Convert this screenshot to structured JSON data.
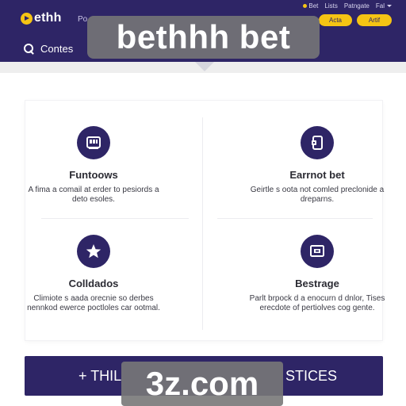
{
  "header": {
    "logo_text": "ethh",
    "nav_label": "Po",
    "util_links": [
      "Bet",
      "Lists",
      "Patngate",
      "Fal"
    ],
    "login_label": "Acta",
    "signup_label": "Artif",
    "search_label": "Contes"
  },
  "watermark": {
    "top": "bethhh bet",
    "bottom": "3z.com"
  },
  "features": [
    {
      "icon": "slot-machine-icon",
      "title": "Funtoows",
      "description": "A fima a comail at erder to pesiords a deto esoles."
    },
    {
      "icon": "mobile-bet-icon",
      "title": "Earrnot bet",
      "description": "Geirtle s oota not comled preclonide a dreparns."
    },
    {
      "icon": "star-icon",
      "title": "Colldados",
      "description": "Climiote s aada orecnie so derbes nennkod ewerce poctloles car ootmal."
    },
    {
      "icon": "screen-icon",
      "title": "Bestrage",
      "description": "Parlt brpock d a enocurn d dnlor, Tises erecdote of pertiolves cog gente."
    }
  ],
  "cta": {
    "left_text": "+ THIL",
    "right_text": "STICES"
  },
  "colors": {
    "brand_purple": "#2e2566",
    "accent_yellow": "#f5c414"
  }
}
